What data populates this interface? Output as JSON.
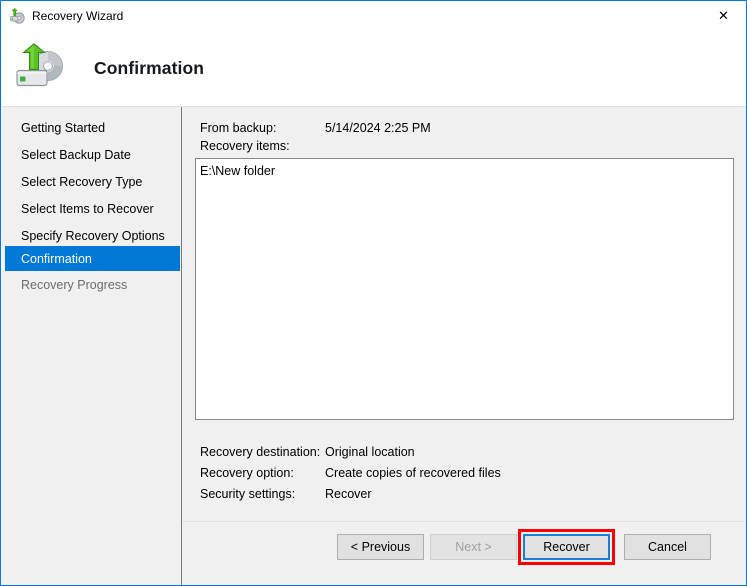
{
  "window": {
    "title": "Recovery Wizard",
    "title_icon": "backup-disc-icon",
    "close_label": "✕",
    "border_color": "#0078d7"
  },
  "header": {
    "title": "Confirmation",
    "icon": "backup-drive-disc-icon"
  },
  "sidebar": {
    "items": [
      {
        "label": "Getting Started",
        "state": "normal"
      },
      {
        "label": "Select Backup Date",
        "state": "normal"
      },
      {
        "label": "Select Recovery Type",
        "state": "normal"
      },
      {
        "label": "Select Items to Recover",
        "state": "normal"
      },
      {
        "label": "Specify Recovery Options",
        "state": "normal"
      },
      {
        "label": "Confirmation",
        "state": "selected"
      },
      {
        "label": "Recovery Progress",
        "state": "disabled"
      }
    ],
    "selected_color": "#0078d7"
  },
  "content": {
    "from_backup_label": "From backup:",
    "from_backup_value": "5/14/2024 2:25 PM",
    "recovery_items_label": "Recovery items:",
    "recovery_items": [
      "E:\\New folder"
    ],
    "details": [
      {
        "label": "Recovery destination:",
        "value": "Original location"
      },
      {
        "label": "Recovery option:",
        "value": "Create copies of recovered files"
      },
      {
        "label": "Security settings:",
        "value": "Recover"
      }
    ]
  },
  "footer": {
    "buttons": [
      {
        "label": "< Previous",
        "state": "normal"
      },
      {
        "label": "Next >",
        "state": "disabled"
      },
      {
        "label": "Recover",
        "state": "focused"
      },
      {
        "label": "Cancel",
        "state": "normal"
      }
    ],
    "annotation_color": "#ff0000"
  }
}
